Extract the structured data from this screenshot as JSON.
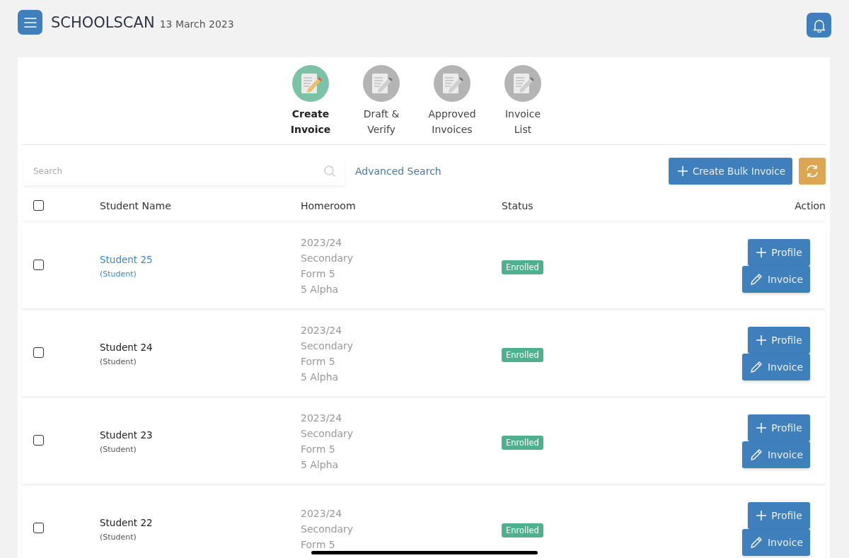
{
  "header": {
    "title": "SCHOOLSCAN",
    "date": "13 March 2023"
  },
  "steps": [
    {
      "label": "Create Invoice",
      "selected": true
    },
    {
      "label": "Draft & Verify",
      "selected": false
    },
    {
      "label": "Approved Invoices",
      "selected": false
    },
    {
      "label": "Invoice List",
      "selected": false
    }
  ],
  "search": {
    "placeholder": "Search",
    "advanced_link": "Advanced Search"
  },
  "toolbar": {
    "create_button": "Create Bulk Invoice"
  },
  "table": {
    "columns": [
      "Student Name",
      "Homeroom",
      "Status",
      "Action"
    ],
    "header_checked": false,
    "rows": [
      {
        "name": "Student 25",
        "role": "(Student)",
        "highlighted": true,
        "checked": false,
        "homeroom": [
          "2023/24",
          "Secondary",
          "Form 5",
          "5 Alpha"
        ],
        "status": "Enrolled",
        "actions": [
          "Profile",
          "Invoice"
        ]
      },
      {
        "name": "Student 24",
        "role": "(Student)",
        "highlighted": false,
        "checked": false,
        "homeroom": [
          "2023/24",
          "Secondary",
          "Form 5",
          "5 Alpha"
        ],
        "status": "Enrolled",
        "actions": [
          "Profile",
          "Invoice"
        ]
      },
      {
        "name": "Student 23",
        "role": "(Student)",
        "highlighted": false,
        "checked": false,
        "homeroom": [
          "2023/24",
          "Secondary",
          "Form 5",
          "5 Alpha"
        ],
        "status": "Enrolled",
        "actions": [
          "Profile",
          "Invoice"
        ]
      },
      {
        "name": "Student 22",
        "role": "(Student)",
        "highlighted": false,
        "checked": false,
        "homeroom": [
          "2023/24",
          "Secondary",
          "Form 5"
        ],
        "status": "Enrolled",
        "actions": [
          "Profile",
          "Invoice"
        ]
      }
    ]
  }
}
